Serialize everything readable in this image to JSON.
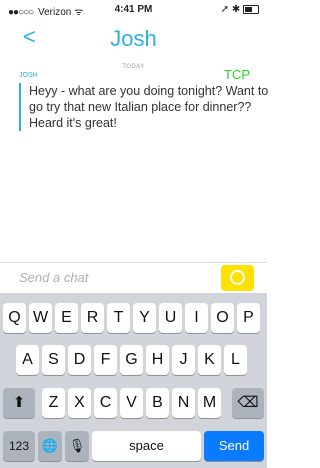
{
  "status_bar": {
    "signal_dots": "●●○○○",
    "carrier": "Verizon",
    "wifi_glyph": "ᯤ",
    "time": "4:41 PM",
    "location_glyph": "➚",
    "bluetooth_glyph": "✱"
  },
  "nav": {
    "back": "<",
    "title": "Josh"
  },
  "chat": {
    "date_label": "TODAY",
    "sender": "JOSH",
    "corner_label": "TCP",
    "message": "Heyy - what are you doing tonight? Want to go try that new Italian place for dinner?? Heard it's great!"
  },
  "compose": {
    "placeholder": "Send a chat"
  },
  "keyboard": {
    "row1": [
      "Q",
      "W",
      "E",
      "R",
      "T",
      "Y",
      "U",
      "I",
      "O",
      "P"
    ],
    "row2": [
      "A",
      "S",
      "D",
      "F",
      "G",
      "H",
      "J",
      "K",
      "L"
    ],
    "row3": [
      "Z",
      "X",
      "C",
      "V",
      "B",
      "N",
      "M"
    ],
    "shift": "⬆",
    "delete": "⌫",
    "numbers": "123",
    "globe": "🌐",
    "mic": "🎙",
    "space": "space",
    "send": "Send"
  },
  "colors": {
    "accent": "#2ab0e6",
    "tcp_green": "#27d227",
    "camera_yellow": "#ffe100",
    "send_blue": "#0a7aff"
  }
}
